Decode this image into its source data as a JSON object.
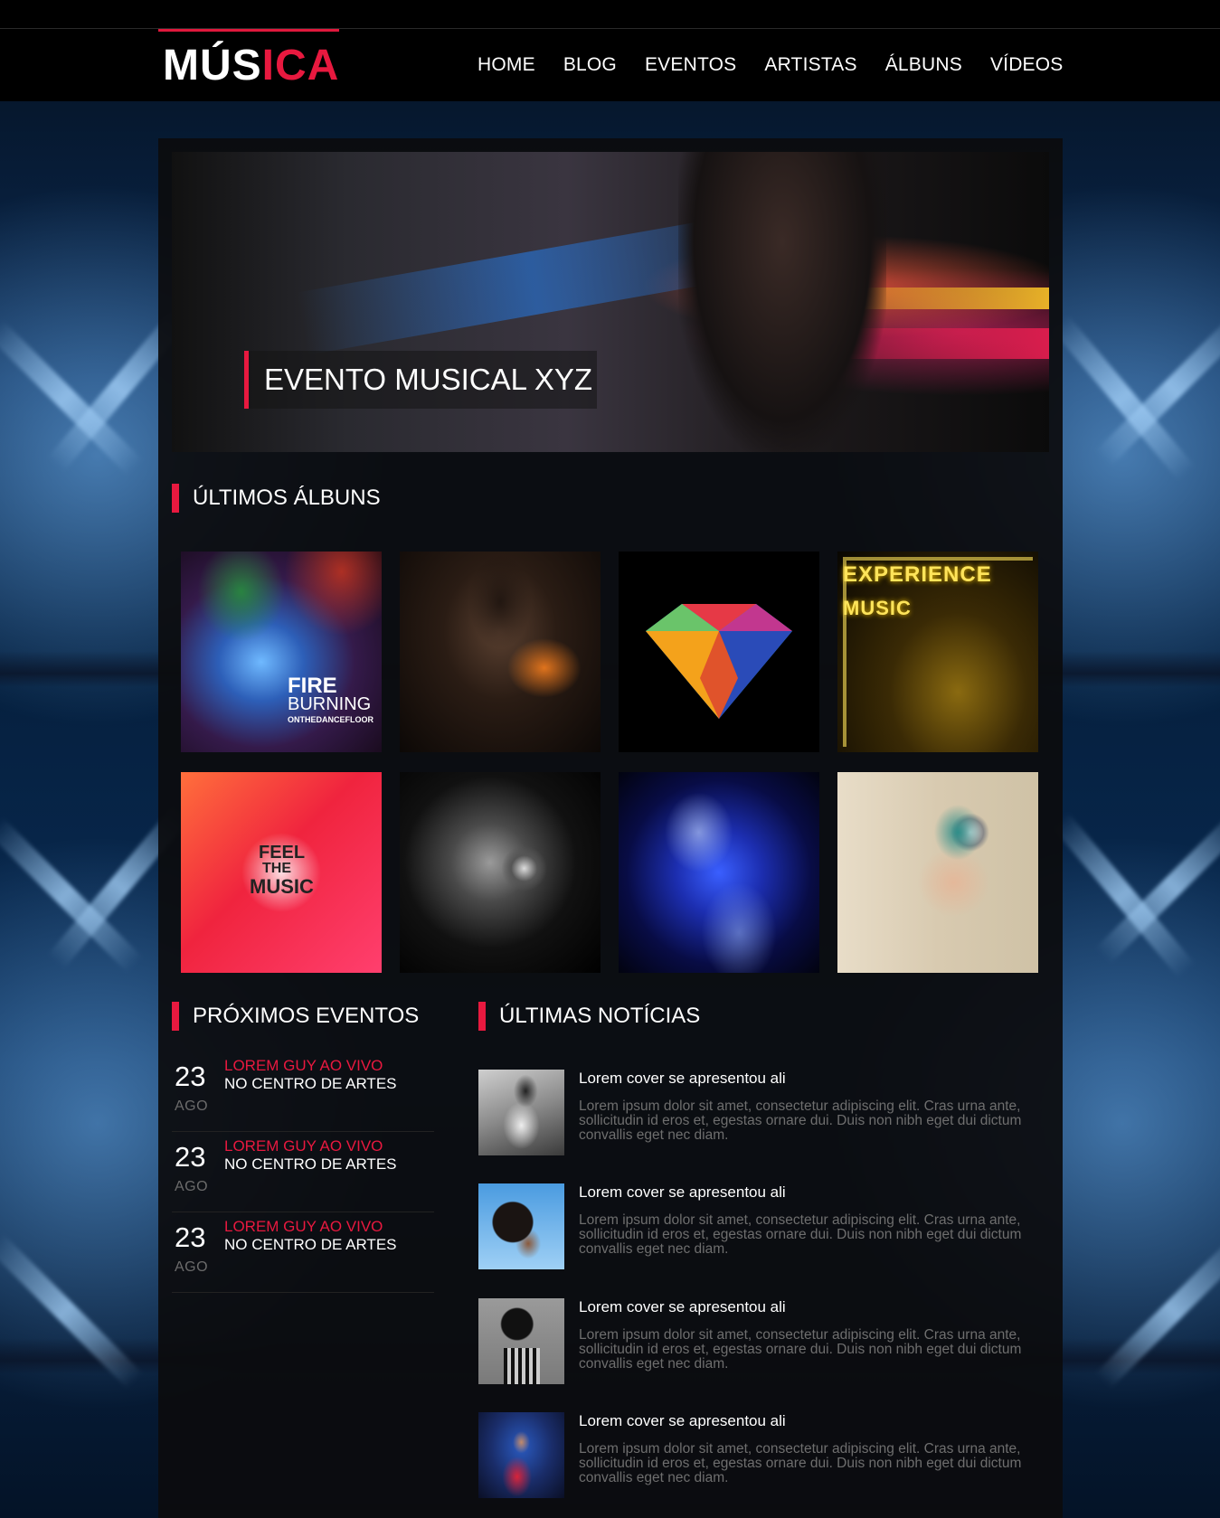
{
  "brand": {
    "logo_white": "MÚS",
    "logo_red": "ICA",
    "accent_color": "#e8193f"
  },
  "nav": {
    "items": [
      "HOME",
      "BLOG",
      "EVENTOS",
      "ARTISTAS",
      "ÁLBUNS",
      "VÍDEOS"
    ]
  },
  "hero": {
    "caption": "EVENTO MUSICAL XYZ"
  },
  "albums_section": {
    "title": "ÚLTIMOS ÁLBUNS",
    "albums": [
      {
        "art": "fire-burning",
        "text_line1": "FIRE",
        "text_line2": "BURNING",
        "text_line3": "ONTHEDANCEFLOOR"
      },
      {
        "art": "hooded-figure"
      },
      {
        "art": "diamond"
      },
      {
        "art": "experience-music",
        "text_line1": "EXPERIENCE",
        "text_line2": "MUSIC"
      },
      {
        "art": "feel-the-music",
        "text_line1": "FEEL",
        "text_line2": "THE",
        "text_line3": "MUSIC"
      },
      {
        "art": "headphones-bw"
      },
      {
        "art": "neon-dj"
      },
      {
        "art": "headphones-color"
      }
    ]
  },
  "events_section": {
    "title": "PRÓXIMOS EVENTOS",
    "events": [
      {
        "day": "23",
        "month": "AGO",
        "name": "LOREM GUY AO VIVO",
        "place": "NO CENTRO DE ARTES"
      },
      {
        "day": "23",
        "month": "AGO",
        "name": "LOREM GUY AO VIVO",
        "place": "NO CENTRO DE ARTES"
      },
      {
        "day": "23",
        "month": "AGO",
        "name": "LOREM GUY AO VIVO",
        "place": "NO CENTRO DE ARTES"
      }
    ]
  },
  "news_section": {
    "title": "ÚLTIMAS NOTÍCIAS",
    "items": [
      {
        "title": "Lorem cover se apresentou ali",
        "body": "Lorem ipsum dolor sit amet, consectetur adipiscing elit. Cras urna ante, sollicitudin id eros et, egestas ornare dui. Duis non nibh eget dui dictum convallis eget nec diam."
      },
      {
        "title": "Lorem cover se apresentou ali",
        "body": "Lorem ipsum dolor sit amet, consectetur adipiscing elit. Cras urna ante, sollicitudin id eros et, egestas ornare dui. Duis non nibh eget dui dictum convallis eget nec diam."
      },
      {
        "title": "Lorem cover se apresentou ali",
        "body": "Lorem ipsum dolor sit amet, consectetur adipiscing elit. Cras urna ante, sollicitudin id eros et, egestas ornare dui. Duis non nibh eget dui dictum convallis eget nec diam."
      },
      {
        "title": "Lorem cover se apresentou ali",
        "body": "Lorem ipsum dolor sit amet, consectetur adipiscing elit. Cras urna ante, sollicitudin id eros et, egestas ornare dui. Duis non nibh eget dui dictum convallis eget nec diam."
      }
    ]
  }
}
